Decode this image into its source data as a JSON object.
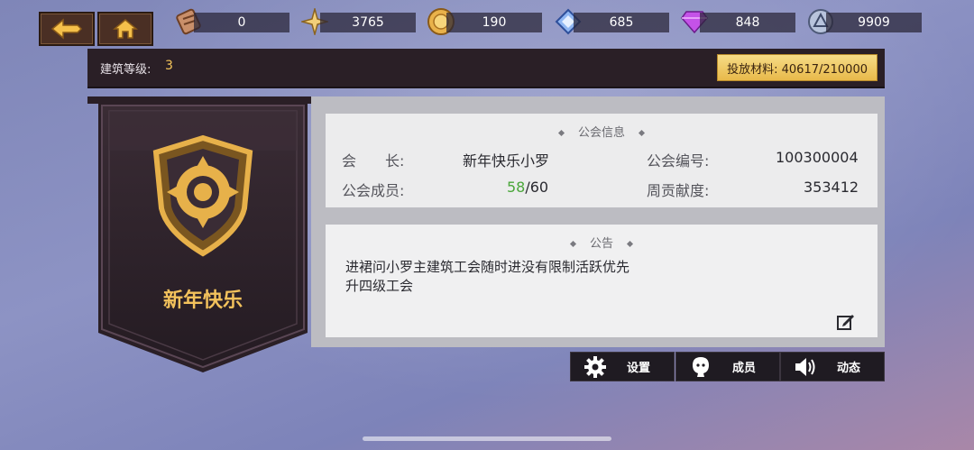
{
  "top_bar": {
    "back_icon": "back-arrow-icon",
    "home_icon": "home-icon",
    "resources": [
      {
        "icon": "scroll-icon",
        "value": "0"
      },
      {
        "icon": "star-shard-icon",
        "value": "3765"
      },
      {
        "icon": "gold-coin-icon",
        "value": "190"
      },
      {
        "icon": "blue-crystal-icon",
        "value": "685"
      },
      {
        "icon": "purple-diamond-icon",
        "value": "848"
      },
      {
        "icon": "silver-orb-icon",
        "value": "9909"
      }
    ]
  },
  "level_bar": {
    "label": "建筑等级:",
    "value": "3",
    "materials": "投放材料: 40617/210000"
  },
  "banner": {
    "emblem_icon": "guild-emblem-icon",
    "name": "新年快乐"
  },
  "guild_info": {
    "title": "公会信息",
    "leader_label": "会　　长:",
    "leader_value": "新年快乐小罗",
    "id_label": "公会编号:",
    "id_value": "100300004",
    "members_label": "公会成员:",
    "members_current": "58",
    "members_max": "/60",
    "weekly_label": "周贡献度:",
    "weekly_value": "353412"
  },
  "notice": {
    "title": "公告",
    "text": "进裙问小罗主建筑工会随时进没有限制活跃优先升四级工会",
    "edit_icon": "edit-icon"
  },
  "buttons": {
    "settings": "设置",
    "members": "成员",
    "news": "动态"
  },
  "colors": {
    "accent_gold": "#f3c25c",
    "member_green": "#4aa63a"
  }
}
